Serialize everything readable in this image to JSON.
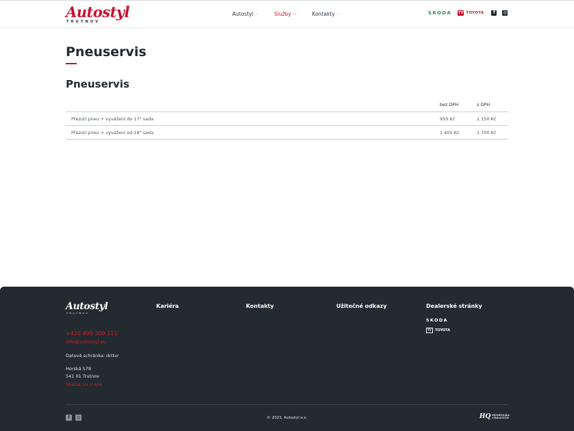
{
  "header": {
    "logo": {
      "word": "Autostyl",
      "sub": "TRUTNOV"
    },
    "nav": [
      {
        "label": "Autostyl"
      },
      {
        "label": "Služby"
      },
      {
        "label": "Kontakty"
      }
    ],
    "brands": {
      "skoda": "SKODA",
      "toyota": "TOYOTA",
      "toyota_mark": "TY"
    },
    "social": {
      "facebook": "f",
      "instagram": "◎"
    }
  },
  "main": {
    "page_title": "Pneuservis",
    "section_title": "Pneuservis",
    "table": {
      "headers": [
        "bez DPH",
        "s DPH"
      ],
      "rows": [
        {
          "name": "Přezutí pneu + vyvážení do 17\" sada",
          "without_vat": "950 Kč",
          "with_vat": "1 150 Kč"
        },
        {
          "name": "Přezutí pneu + vyvážení od 18\" sada",
          "without_vat": "1 405 Kč",
          "with_vat": "1 700 Kč"
        }
      ]
    }
  },
  "footer": {
    "logo": {
      "word": "Autostyl",
      "sub": "TRUTNOV"
    },
    "columns": [
      "Kariéra",
      "Kontakty",
      "Užitečné odkazy",
      "Dealerské stránky"
    ],
    "phone": "+420 499 309 111",
    "email": "info@autostyl.eu",
    "databox": "Datová schránka: drttxr",
    "address_line1": "Horská 579",
    "address_line2": "541 01 Trutnov",
    "map_link": "Ukázat na mapě",
    "brands": {
      "skoda": "SKODA",
      "toyota": "TOYOTA",
      "toyota_mark": "TY"
    },
    "social": {
      "facebook": "f",
      "instagram": "◎"
    },
    "copyright": "© 2023, Autostyl a.s.",
    "creator": {
      "mark": "HQ",
      "line1": "HOMOLKA",
      "line2": "CREATIVE"
    }
  }
}
